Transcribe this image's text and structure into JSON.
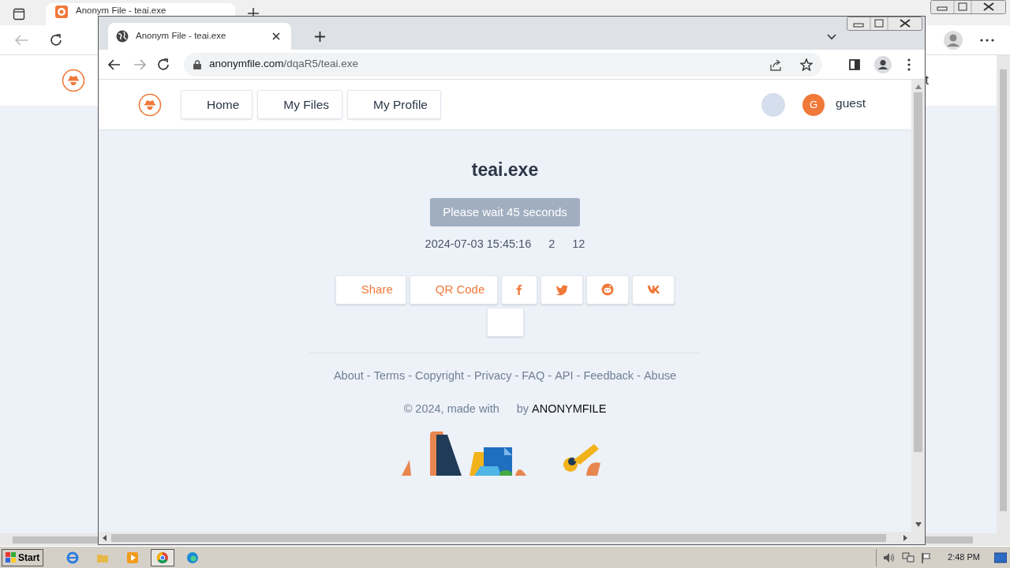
{
  "background_browser": {
    "tab": {
      "title": "Anonym File - teai.exe"
    },
    "page_fragment": "t"
  },
  "browser": {
    "tab": {
      "title": "Anonym File - teai.exe"
    },
    "address": {
      "domain": "anonymfile.com",
      "path": "/dqaR5/teai.exe"
    }
  },
  "nav": {
    "items": [
      {
        "label": "Home"
      },
      {
        "label": "My Files"
      },
      {
        "label": "My Profile"
      }
    ],
    "user": {
      "initial": "G",
      "name": "guest"
    }
  },
  "file": {
    "name": "teai.exe",
    "wait_button": "Please wait 45 seconds",
    "date": "2024-07-03 15:45:16",
    "stat_1": "2",
    "stat_2": "12"
  },
  "share_buttons": [
    {
      "kind": "text",
      "label": "Share"
    },
    {
      "kind": "text",
      "label": "QR Code"
    },
    {
      "kind": "facebook"
    },
    {
      "kind": "twitter"
    },
    {
      "kind": "reddit"
    },
    {
      "kind": "vk"
    },
    {
      "kind": "blank"
    }
  ],
  "footer": {
    "links": [
      "About",
      "Terms",
      "Copyright",
      "Privacy",
      "FAQ",
      "API",
      "Feedback",
      "Abuse"
    ],
    "separator": "-",
    "credit_prefix": "© 2024, made with",
    "credit_by": "by",
    "brand": "ANONYMFILE"
  },
  "taskbar": {
    "start": "Start",
    "clock": "2:48 PM"
  }
}
